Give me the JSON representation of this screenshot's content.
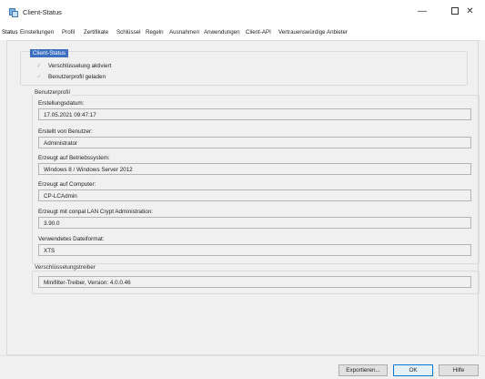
{
  "window": {
    "title": "Client-Status",
    "minimize_glyph": "—",
    "close_glyph": "✕"
  },
  "tabs": [
    {
      "label": "Status"
    },
    {
      "label": "Einstellungen"
    },
    {
      "label": "Profil"
    },
    {
      "label": "Zertifikate"
    },
    {
      "label": "Schlüssel"
    },
    {
      "label": "Regeln"
    },
    {
      "label": "Ausnahmen"
    },
    {
      "label": "Anwendungen"
    },
    {
      "label": "Client-API"
    },
    {
      "label": "Vertrauenswürdige Anbieter"
    }
  ],
  "client_status": {
    "legend": "Client-Status",
    "checks": [
      {
        "label": "Verschlüsselung aktiviert",
        "checked": true
      },
      {
        "label": "Benutzerprofil geladen",
        "checked": true
      }
    ],
    "check_icon": "check-icon"
  },
  "benutzerprofil": {
    "legend": "Benutzerprofil",
    "fields": [
      {
        "label": "Erstellungsdatum:",
        "value": "17.05.2021 09:47:17"
      },
      {
        "label": "Erstellt von Benutzer:",
        "value": "Administrator"
      },
      {
        "label": "Erzeugt auf Betriebssystem:",
        "value": "Windows 8 / Windows Server 2012"
      },
      {
        "label": "Erzeugt auf Computer:",
        "value": "CP-LCAdmin"
      },
      {
        "label": "Erzeugt mit conpal LAN Crypt Administration:",
        "value": "3.90.0"
      },
      {
        "label": "Verwendetes Dateiformat:",
        "value": "XTS"
      }
    ]
  },
  "treiber": {
    "legend": "Verschlüsselungstreiber",
    "value": "Minifilter-Treiber, Version: 4.0.0.46"
  },
  "footer": {
    "export_label": "Exportieren...",
    "ok_label": "OK",
    "help_label": "Hilfe"
  },
  "colors": {
    "accent": "#3c6fbf",
    "primary_button_border": "#0078d7"
  }
}
